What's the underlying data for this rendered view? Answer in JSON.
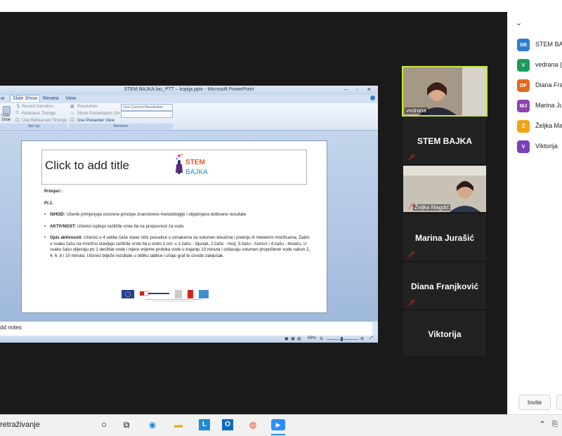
{
  "panel": {
    "chevron": "⌄",
    "participants": [
      {
        "initials": "SB",
        "name": "STEM BAJKA",
        "color": "#2e7bcf"
      },
      {
        "initials": "V",
        "name": "vedrana (",
        "color": "#1a9c5b"
      },
      {
        "initials": "DF",
        "name": "Diana Fra",
        "color": "#e06b1f"
      },
      {
        "initials": "MJ",
        "name": "Marina Ju",
        "color": "#8e44ad"
      },
      {
        "initials": "Ž",
        "name": "Željka Ma",
        "color": "#f2a413"
      },
      {
        "initials": "V",
        "name": "Viktorija",
        "color": "#7b3fb8"
      }
    ],
    "invite_label": "Invite"
  },
  "tiles": {
    "vedrana": {
      "label": "vedrana"
    },
    "stem": {
      "name": "STEM BAJKA"
    },
    "zeljka": {
      "label": "Željka Magdić"
    },
    "marina": {
      "name": "Marina Jurašić"
    },
    "diana": {
      "name": "Diana Franjković"
    },
    "viktorija": {
      "name": "Viktorija"
    }
  },
  "powerpoint": {
    "window_title": "STEM BAJKA bio_PTT – kopija.pptx - Microsoft PowerPoint",
    "tabs": [
      "w",
      "Slide Show",
      "Review",
      "View"
    ],
    "ribbon": {
      "hide_slide": "Hide Slide",
      "record_narration": "Record Narration",
      "rehearse_timings": "Rehearse Timings",
      "use_rehearsed_timings": "Use Rehearsed Timings",
      "set_up_group": "Set Up",
      "resolution_label": "Resolution:",
      "resolution_value": "Use Current Resolution",
      "show_on_label": "Show Presentation On:",
      "presenter_view": "Use Presenter View",
      "monitors_group": "Monitors"
    },
    "slide": {
      "title_placeholder": "Click to add title",
      "logo_text": "STEM BAJKA",
      "heading": "Primjeri :",
      "subheading": "Pr.1.",
      "ishod_label": "ISHOD:",
      "ishod_text": "Učenik primjenjuje osnovne principe znanstvene metodologije i objašnjava dobivene rezultate",
      "aktivnost_label": "AKTIVNOST:",
      "aktivnost_text": "Učenici ispituju različite vrste tla na propusnost za vodu",
      "opis_label": "Opis aktivnosti:",
      "opis_text": "Učenici u 4 velike čaše stave niže posudice s oznakama za volumen tekućina i prekriju ih metalnim mrežicama. Zatim u svaku čašu na mrežicu stavljaju različite vrste tla u visini 1 cm: u 1.čašu - šljunak, 2.čašu - mulj, 3.čašu - humus i 4.čašu - ilovaču. U svaku čašu ulijevaju po 1 decilitar vode i mjere vrijeme protoka vode u trajanju 10 minuta i očitavaju volumen propuštene vode nakon 2, 4, 6, 8 i 10 minuta. Učenici bilježe rezultate u obliku tablice i crtaju graf te izvode zaključak."
    },
    "notes_placeholder": "dd notes",
    "zoom_level": "68%"
  },
  "taskbar": {
    "search_text": "retraživanje"
  }
}
